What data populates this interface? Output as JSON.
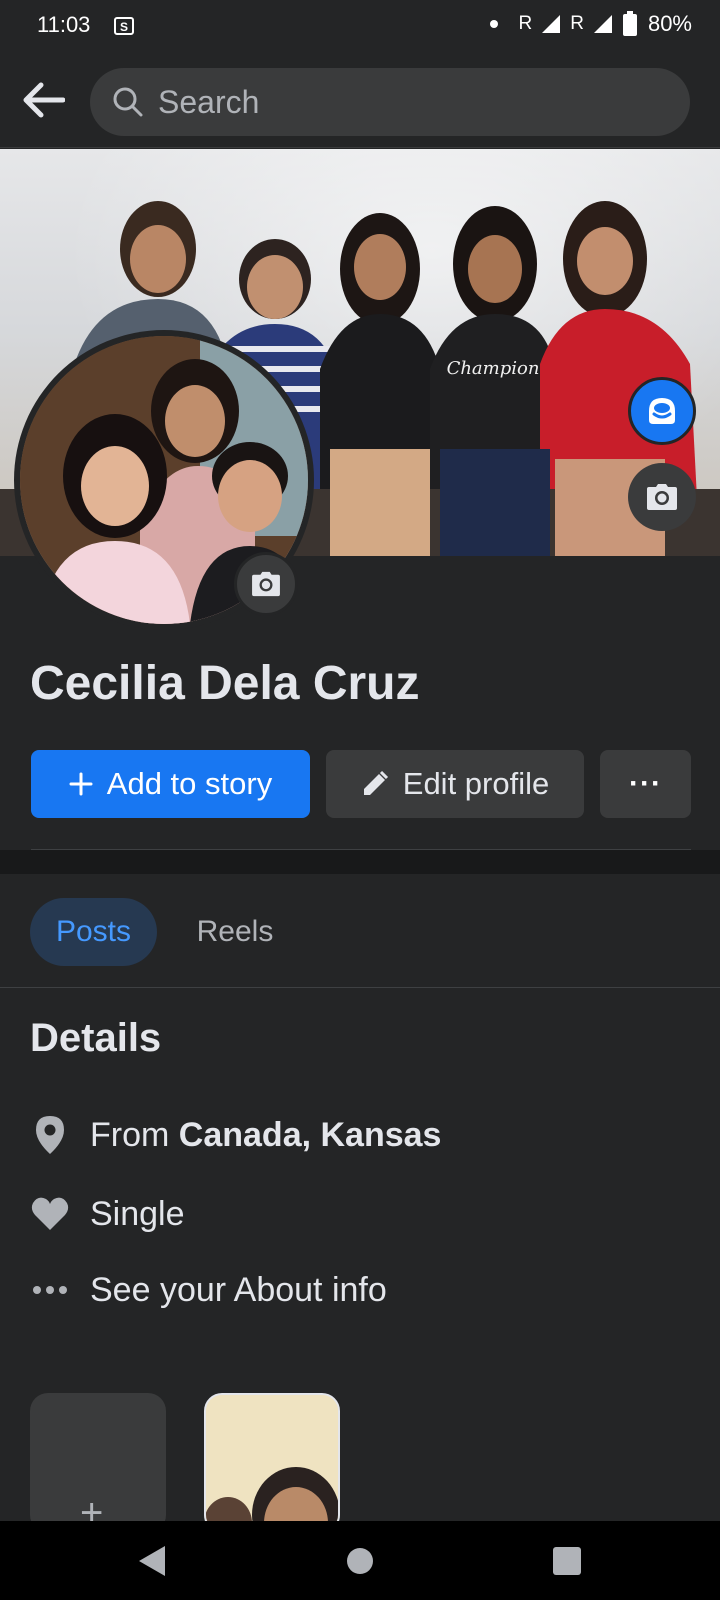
{
  "status_bar": {
    "time": "11:03",
    "signal_1": "R",
    "signal_2": "R",
    "battery": "80%"
  },
  "top_bar": {
    "search_placeholder": "Search"
  },
  "profile": {
    "name": "Cecilia Dela Cruz"
  },
  "actions": {
    "add_story_label": "Add to story",
    "edit_profile_label": "Edit profile",
    "more_label": "···"
  },
  "tabs": [
    {
      "label": "Posts",
      "active": true
    },
    {
      "label": "Reels",
      "active": false
    }
  ],
  "details": {
    "title": "Details",
    "from_prefix": "From ",
    "from_place": "Canada, Kansas",
    "relationship": "Single",
    "about_link": "See your About info"
  },
  "featured": {
    "add_symbol": "+"
  },
  "colors": {
    "background": "#242526",
    "accent": "#1877f2",
    "tab_active_bg": "#263951",
    "tab_active_text": "#4599ff"
  },
  "icons": {
    "back": "arrow-left-icon",
    "search": "search-icon",
    "cover_camera": "camera-icon",
    "avatar": "avatar-icon",
    "location": "location-pin-icon",
    "relationship": "heart-icon",
    "about": "ellipsis-icon"
  }
}
